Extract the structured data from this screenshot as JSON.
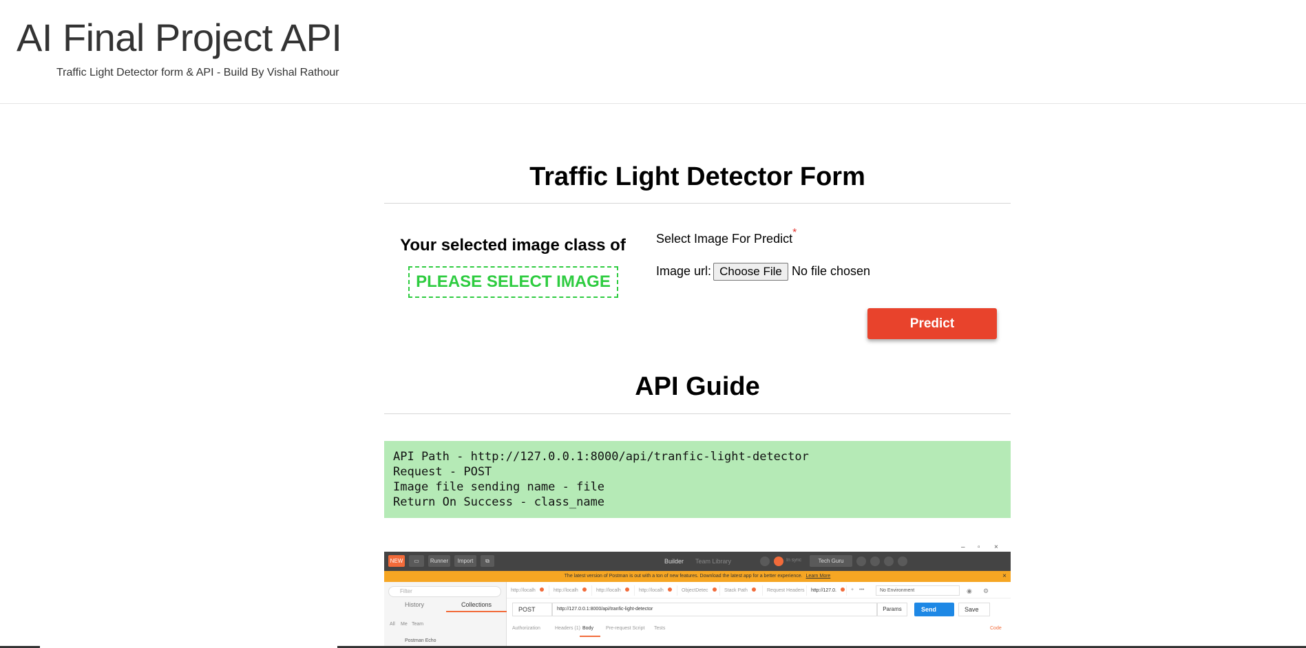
{
  "header": {
    "title": "AI Final Project API",
    "subtitle": "Traffic Light Detector form & API - Build By Vishal Rathour"
  },
  "form": {
    "title": "Traffic Light Detector Form",
    "result_label": "Your selected image class of",
    "result_value": "PLEASE SELECT IMAGE",
    "result_color": "#2ecc40",
    "file_title": "Select Image For Predict",
    "required_mark": "*",
    "url_label": "Image url:",
    "choose_file_label": "Choose File",
    "no_file_text": "No file chosen",
    "predict_label": "Predict",
    "predict_color": "#e8432c"
  },
  "api_guide": {
    "title": "API Guide",
    "lines": [
      "API Path - http://127.0.0.1:8000/api/tranfic-light-detector",
      "Request - POST",
      "Image file sending name - file",
      "Return On Success - class_name"
    ],
    "code_bg": "#b5eab6"
  },
  "postman": {
    "window_controls": [
      "–",
      "▫",
      "×"
    ],
    "toolbar": {
      "new": "NEW",
      "runner": "Runner",
      "import": "Import",
      "builder": "Builder",
      "team_library": "Team Library",
      "in_sync": "In sync",
      "workspace": "Tech Guru"
    },
    "banner": "The latest version of Postman is out with a ton of new features. Download the latest app for a better experience.",
    "banner_link": "Learn More",
    "sidebar": {
      "filter_placeholder": "Filter",
      "tabs": [
        "History",
        "Collections"
      ],
      "subtabs": [
        "All",
        "Me",
        "Team"
      ],
      "first_item": "Postman Echo"
    },
    "request_tabs": [
      "http://localh",
      "http://localh",
      "http://localh",
      "http://localh",
      "ObjectDetec",
      "Stack Path",
      "Request Headers",
      "http://127.0."
    ],
    "environment": "No Environment",
    "method": "POST",
    "url": "http://127.0.0.1:8000/api/tranfic-light-detector",
    "params": "Params",
    "send": "Send",
    "save": "Save",
    "subtabs": [
      "Authorization",
      "Headers (1)",
      "Body",
      "Pre-request Script",
      "Tests"
    ],
    "code_link": "Code"
  }
}
